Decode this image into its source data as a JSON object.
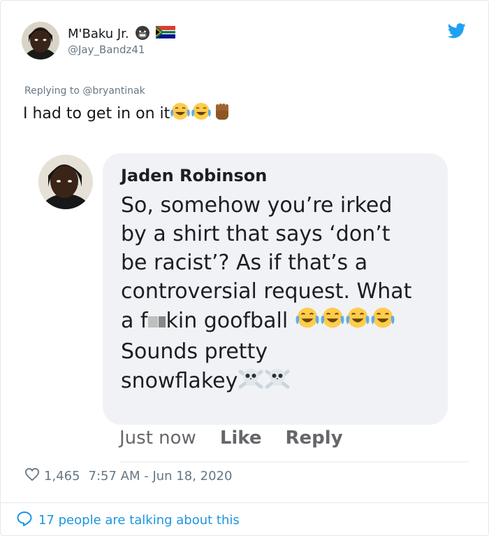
{
  "author": {
    "display_name": "M'Baku Jr.",
    "handle": "@Jay_Bandz41",
    "badge_icons": [
      "gorilla-emoji",
      "south-africa-flag-emoji"
    ]
  },
  "reply": {
    "prefix": "Replying to ",
    "target": "@bryantinak"
  },
  "tweet": {
    "text": "I had to get in on it",
    "emojis": [
      "face-with-tears-of-joy",
      "face-with-tears-of-joy",
      "raised-fist-medium-dark"
    ]
  },
  "embedded_comment": {
    "name": "Jaden Robinson",
    "lines": [
      "So, somehow you’re irked",
      "by a shirt that says ‘don’t",
      "be racist’? As if that’s a",
      "controversial request. What"
    ],
    "line5_start": "a f",
    "line5_end": "kin goofball",
    "line6": "Sounds pretty",
    "line7": "snowflakey",
    "timestamp": "Just now",
    "like_label": "Like",
    "reply_label": "Reply"
  },
  "meta": {
    "likes": "1,465",
    "datetime": "7:57 AM - Jun 18, 2020"
  },
  "footer": {
    "talking": "17 people are talking about this"
  },
  "colors": {
    "twitter_blue": "#1da1f2",
    "link_blue": "#1b95e0",
    "muted": "#657786",
    "bubble_bg": "#f0f2f5"
  }
}
